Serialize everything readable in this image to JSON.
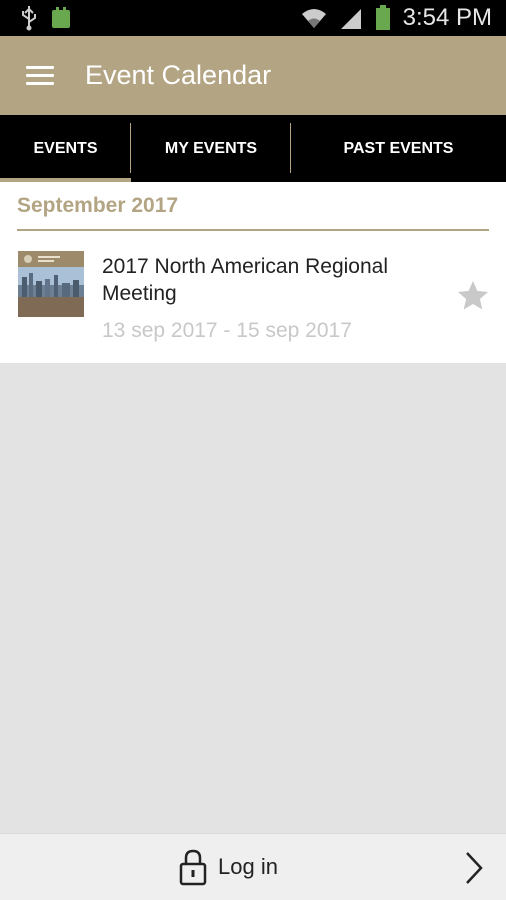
{
  "status_bar": {
    "time": "3:54 PM",
    "icons": [
      "usb-icon",
      "android-icon",
      "wifi-icon",
      "signal-icon",
      "battery-icon"
    ]
  },
  "app_bar": {
    "title": "Event Calendar",
    "menu_icon": "menu-icon"
  },
  "tabs": [
    {
      "label": "EVENTS",
      "active": true
    },
    {
      "label": "MY EVENTS",
      "active": false
    },
    {
      "label": "PAST EVENTS",
      "active": false
    }
  ],
  "list": {
    "month_header": "September 2017",
    "events": [
      {
        "title": "2017 North American Regional Meeting",
        "dates": "13 sep 2017 - 15 sep 2017",
        "starred": false
      }
    ]
  },
  "bottom_bar": {
    "login_label": "Log in"
  },
  "colors": {
    "accent": "#b3a584",
    "tab_bg": "#000000",
    "content_bg": "#e3e3e3"
  }
}
